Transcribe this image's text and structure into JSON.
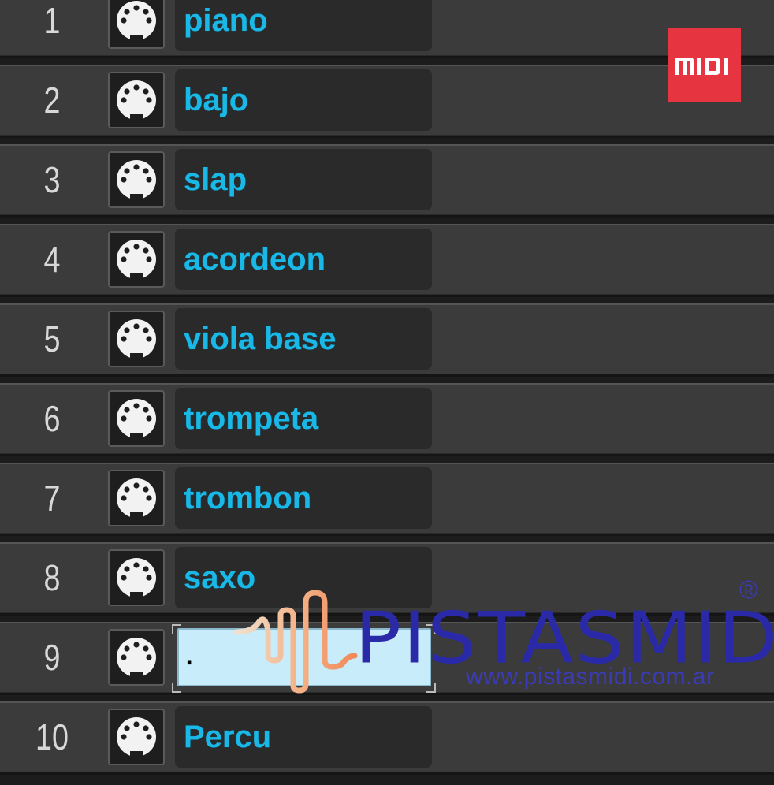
{
  "tracks": [
    {
      "number": "1",
      "name": "piano"
    },
    {
      "number": "2",
      "name": "bajo"
    },
    {
      "number": "3",
      "name": "slap"
    },
    {
      "number": "4",
      "name": "acordeon"
    },
    {
      "number": "5",
      "name": "viola base"
    },
    {
      "number": "6",
      "name": "trompeta"
    },
    {
      "number": "7",
      "name": "trombon"
    },
    {
      "number": "8",
      "name": "saxo"
    },
    {
      "number": "9",
      "name": "",
      "editing": true
    },
    {
      "number": "10",
      "name": "Percu"
    }
  ],
  "track_icon": "midi-port-icon",
  "logo": {
    "text": "MIDI",
    "color": "#e63440"
  },
  "watermark": {
    "brand": "PISTASMIDI",
    "url": "www.pistasmidi.com.ar",
    "registered": "®",
    "color": "#2a2aa8"
  },
  "colors": {
    "track_name": "#1ab8e6",
    "row_bg": "#3b3b3b",
    "edit_bg": "#c9ecfa"
  }
}
